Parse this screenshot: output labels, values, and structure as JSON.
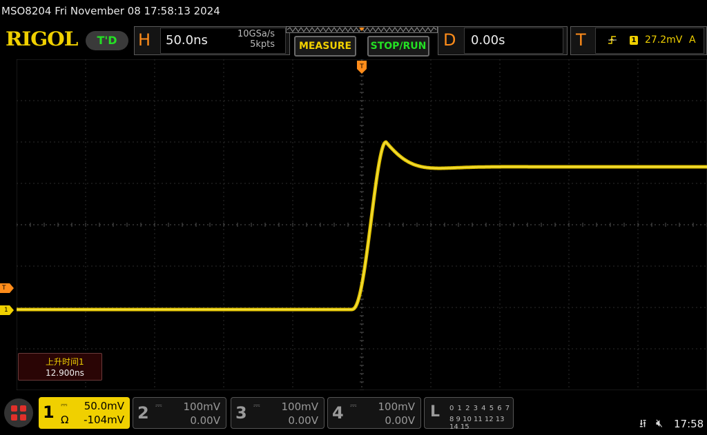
{
  "titlebar": {
    "model_datetime": "MSO8204  Fri November 08 17:58:13 2024"
  },
  "logo": {
    "text": "RIGOL"
  },
  "status": {
    "run_state": "T'D"
  },
  "horizontal": {
    "letter": "H",
    "timebase": "50.0ns",
    "sample_rate": "10GSa/s",
    "memory_depth": "5kpts"
  },
  "buttons": {
    "measure": "MEASURE",
    "stop_run": "STOP/RUN"
  },
  "delay": {
    "letter": "D",
    "value": "0.00s"
  },
  "trigger": {
    "letter": "T",
    "slope_icon": "rising-edge-icon",
    "source": "1",
    "level": "27.2mV",
    "mode": "A"
  },
  "markers": {
    "trigger_level": "T",
    "channel1": "1",
    "trigger_position": "T"
  },
  "measurement": {
    "name": "上升时间1",
    "value": "12.900ns"
  },
  "channels": [
    {
      "num": "1",
      "coupling": "DC",
      "impedance": "Ω",
      "scale": "50.0mV",
      "offset": "-104mV"
    },
    {
      "num": "2",
      "coupling": "DC",
      "scale": "100mV",
      "offset": "0.00V"
    },
    {
      "num": "3",
      "coupling": "DC",
      "scale": "100mV",
      "offset": "0.00V"
    },
    {
      "num": "4",
      "coupling": "DC",
      "scale": "100mV",
      "offset": "0.00V"
    }
  ],
  "logic": {
    "letter": "L",
    "row1": "0 1 2 3   4 5 6 7",
    "row2": "8 9 10 11 12 13 14 15"
  },
  "systray": {
    "clock": "17:58",
    "usb_icon": "usb-icon",
    "speaker_icon": "speaker-muted-icon"
  },
  "colors": {
    "ch1": "#f0d000",
    "accent": "#ff8c1a",
    "green": "#24e024",
    "grid": "#3a3a3a"
  },
  "waveform": {
    "grid_divisions": [
      10,
      8
    ],
    "baseline_div": -2.05,
    "settled_div": 1.4,
    "overshoot_div": 2.0,
    "edge_start_div": 0.0
  }
}
